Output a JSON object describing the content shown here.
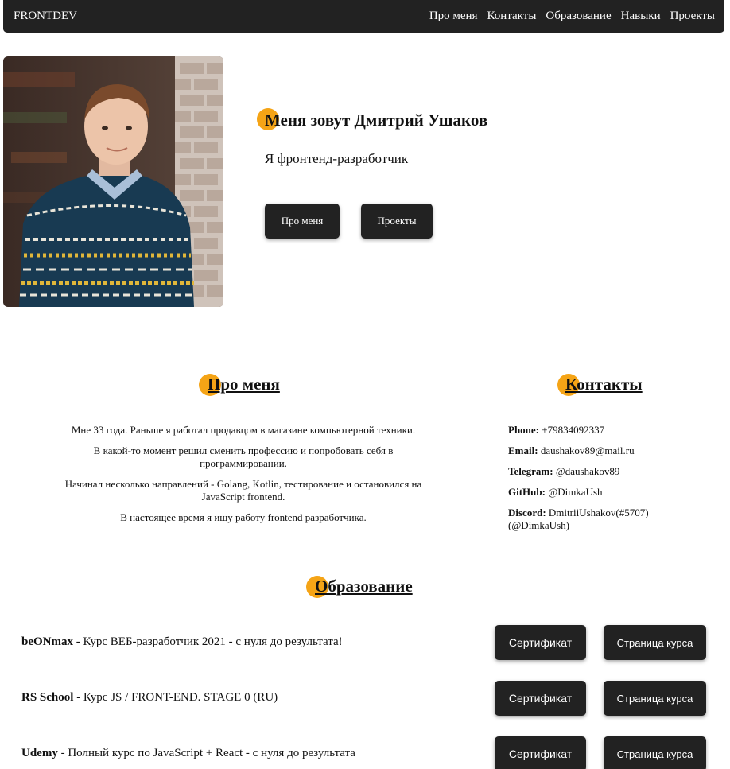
{
  "navbar": {
    "brand": "FRONTDEV",
    "links": [
      "Про меня",
      "Контакты",
      "Образование",
      "Навыки",
      "Проекты"
    ]
  },
  "hero": {
    "title": "Меня зовут Дмитрий Ушаков",
    "subtitle": "Я фронтенд-разработчик",
    "buttons": [
      "Про меня",
      "Проекты"
    ]
  },
  "about": {
    "title": "Про меня",
    "paragraphs": [
      "Мне 33 года. Раньше я работал продавцом в магазине компьютерной техники.",
      "В какой-то момент решил сменить профессию и попробовать себя в программировании.",
      "Начинал несколько направлений - Golang, Kotlin, тестирование и остановился на JavaScript frontend.",
      "В настоящее время я ищу работу frontend разработчика."
    ]
  },
  "contacts": {
    "title": "Контакты",
    "items": [
      {
        "label": "Phone:",
        "value": "+79834092337"
      },
      {
        "label": "Email:",
        "value": "daushakov89@mail.ru"
      },
      {
        "label": "Telegram:",
        "value": "@daushakov89"
      },
      {
        "label": "GitHub:",
        "value": "@DimkaUsh"
      },
      {
        "label": "Discord:",
        "value": "DmitriiUshakov(#5707) (@DimkaUsh)"
      }
    ]
  },
  "education": {
    "title": "Образование",
    "courses": [
      {
        "school": "beONmax",
        "desc": " - Курс ВЕБ-разработчик 2021 - с нуля до результата!"
      },
      {
        "school": "RS School",
        "desc": " - Курс JS / FRONT-END. STAGE 0 (RU)"
      },
      {
        "school": "Udemy",
        "desc": " - Полный курс по JavaScript + React - с нуля до результата"
      }
    ],
    "cert_label": "Сертификат",
    "course_page_label": "Страница курса"
  },
  "colors": {
    "dark": "#222222",
    "accent": "#f5a416"
  }
}
